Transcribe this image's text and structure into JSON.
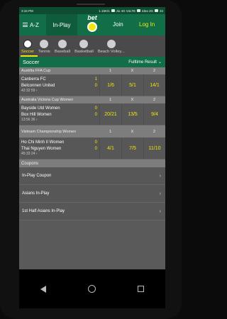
{
  "status_bar": {
    "time": "3:15 PM",
    "speed": "1.15K/s",
    "network": "Jio 4G VoLTE",
    "network2": "Idea 3G",
    "battery": "34"
  },
  "nav": {
    "az_label": "A-Z",
    "inplay_label": "In-Play",
    "logo_text": "bet",
    "join_label": "Join",
    "login_label": "Log In"
  },
  "sport_tabs": [
    {
      "label": "Soccer",
      "icon": "soccer-ball-icon",
      "active": true
    },
    {
      "label": "Tennis",
      "icon": "tennis-ball-icon"
    },
    {
      "label": "Baseball",
      "icon": "baseball-icon"
    },
    {
      "label": "Basketball",
      "icon": "basketball-icon"
    },
    {
      "label": "Beach Volley...",
      "icon": "beach-volleyball-icon"
    }
  ],
  "section": {
    "title": "Soccer",
    "filter": "Fulltime Result"
  },
  "competitions": [
    {
      "name": "Austrlia FFA Cup",
      "cols": [
        "1",
        "X",
        "2"
      ],
      "event": {
        "home": "Canberra FC",
        "home_score": "1",
        "away": "Belconnen United",
        "away_score": "0",
        "clock": "42:32  59 ›",
        "odds": [
          "1/6",
          "5/1",
          "14/1"
        ]
      }
    },
    {
      "name": "Australia Victoria Cup Women",
      "cols": [
        "1",
        "X",
        "2"
      ],
      "event": {
        "home": "Bayside Utd Women",
        "home_score": "0",
        "away": "Box Hill Women",
        "away_score": "0",
        "clock": "13:56  36 ›",
        "odds": [
          "20/21",
          "13/5",
          "9/4"
        ]
      }
    },
    {
      "name": "Vietnam Championship Women",
      "cols": [
        "1",
        "X",
        "2"
      ],
      "event": {
        "home": "Ho Chi Minh II Women",
        "home_score": "0",
        "away": "Thai Nguyen Women",
        "away_score": "0",
        "clock": "45:33  24 ›",
        "odds": [
          "4/1",
          "7/5",
          "11/10"
        ]
      }
    }
  ],
  "coupons": {
    "header": "Coupons",
    "items": [
      "In-Play Coupon",
      "Asians In-Play",
      "1st Half Asians In-Play"
    ]
  }
}
